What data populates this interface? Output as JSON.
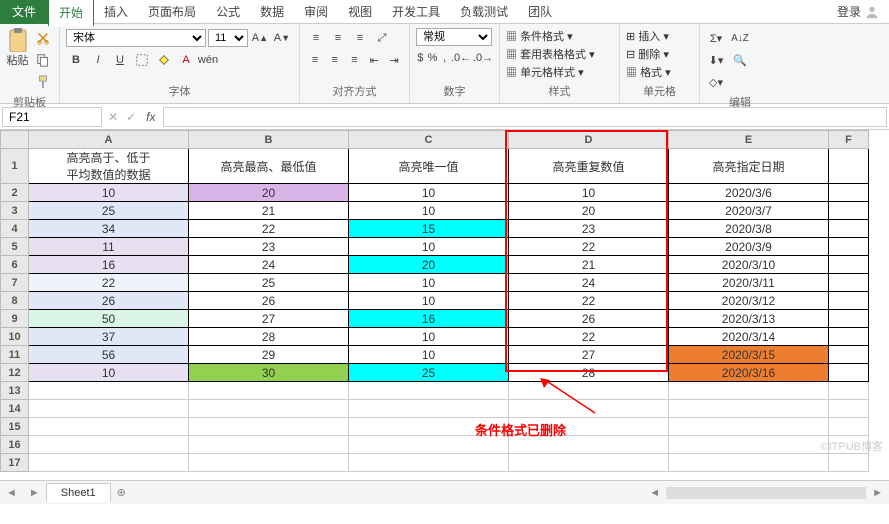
{
  "tabs": {
    "file": "文件",
    "home": "开始",
    "insert": "插入",
    "page_layout": "页面布局",
    "formulas": "公式",
    "data": "数据",
    "review": "审阅",
    "view": "视图",
    "dev": "开发工具",
    "load_test": "负载测试",
    "team": "团队"
  },
  "login": "登录",
  "ribbon": {
    "clipboard": {
      "paste": "粘贴",
      "group": "剪贴板"
    },
    "font": {
      "name": "宋体",
      "size": "11",
      "group": "字体",
      "wen": "wén"
    },
    "alignment": {
      "group": "对齐方式"
    },
    "number": {
      "format": "常规",
      "group": "数字"
    },
    "styles": {
      "cond": "条件格式",
      "table": "套用表格格式",
      "cell": "单元格样式",
      "group": "样式"
    },
    "cells": {
      "insert": "插入",
      "delete": "删除",
      "format": "格式",
      "group": "单元格"
    },
    "editing": {
      "group": "编辑"
    }
  },
  "namebox": "F21",
  "columns": [
    "A",
    "B",
    "C",
    "D",
    "E",
    "F"
  ],
  "headers": {
    "A": "高亮高于、低于\n平均数值的数据",
    "B": "高亮最高、最低值",
    "C": "高亮唯一值",
    "D": "高亮重复数值",
    "E": "高亮指定日期"
  },
  "rows": [
    {
      "n": 2,
      "A": "10",
      "B": "20",
      "C": "10",
      "D": "10",
      "E": "2020/3/6",
      "hlA": "hl-lav",
      "hlB": "hl-purple"
    },
    {
      "n": 3,
      "A": "25",
      "B": "21",
      "C": "10",
      "D": "20",
      "E": "2020/3/7",
      "hlA": "hl-blue-lt"
    },
    {
      "n": 4,
      "A": "34",
      "B": "22",
      "C": "15",
      "D": "23",
      "E": "2020/3/8",
      "hlA": "hl-blue-lt",
      "hlC": "hl-cyan"
    },
    {
      "n": 5,
      "A": "11",
      "B": "23",
      "C": "10",
      "D": "22",
      "E": "2020/3/9",
      "hlA": "hl-lav"
    },
    {
      "n": 6,
      "A": "16",
      "B": "24",
      "C": "20",
      "D": "21",
      "E": "2020/3/10",
      "hlA": "hl-lav",
      "hlC": "hl-cyan"
    },
    {
      "n": 7,
      "A": "22",
      "B": "25",
      "C": "10",
      "D": "24",
      "E": "2020/3/11",
      "hlA": "hl-blue-vlt"
    },
    {
      "n": 8,
      "A": "26",
      "B": "26",
      "C": "10",
      "D": "22",
      "E": "2020/3/12",
      "hlA": "hl-blue-lt"
    },
    {
      "n": 9,
      "A": "50",
      "B": "27",
      "C": "16",
      "D": "26",
      "E": "2020/3/13",
      "hlA": "hl-mint",
      "hlC": "hl-cyan"
    },
    {
      "n": 10,
      "A": "37",
      "B": "28",
      "C": "10",
      "D": "22",
      "E": "2020/3/14",
      "hlA": "hl-blue-lt"
    },
    {
      "n": 11,
      "A": "56",
      "B": "29",
      "C": "10",
      "D": "27",
      "E": "2020/3/15",
      "hlA": "hl-blue-lt",
      "hlE": "hl-orange"
    },
    {
      "n": 12,
      "A": "10",
      "B": "30",
      "C": "25",
      "D": "28",
      "E": "2020/3/16",
      "hlA": "hl-lav",
      "hlB": "hl-green",
      "hlC": "hl-cyan",
      "hlE": "hl-orange"
    }
  ],
  "empty_rows": [
    13,
    14,
    15,
    16,
    17
  ],
  "annotation": "条件格式已删除",
  "sheet_tab": "Sheet1",
  "watermark": "©ITPUB博客"
}
